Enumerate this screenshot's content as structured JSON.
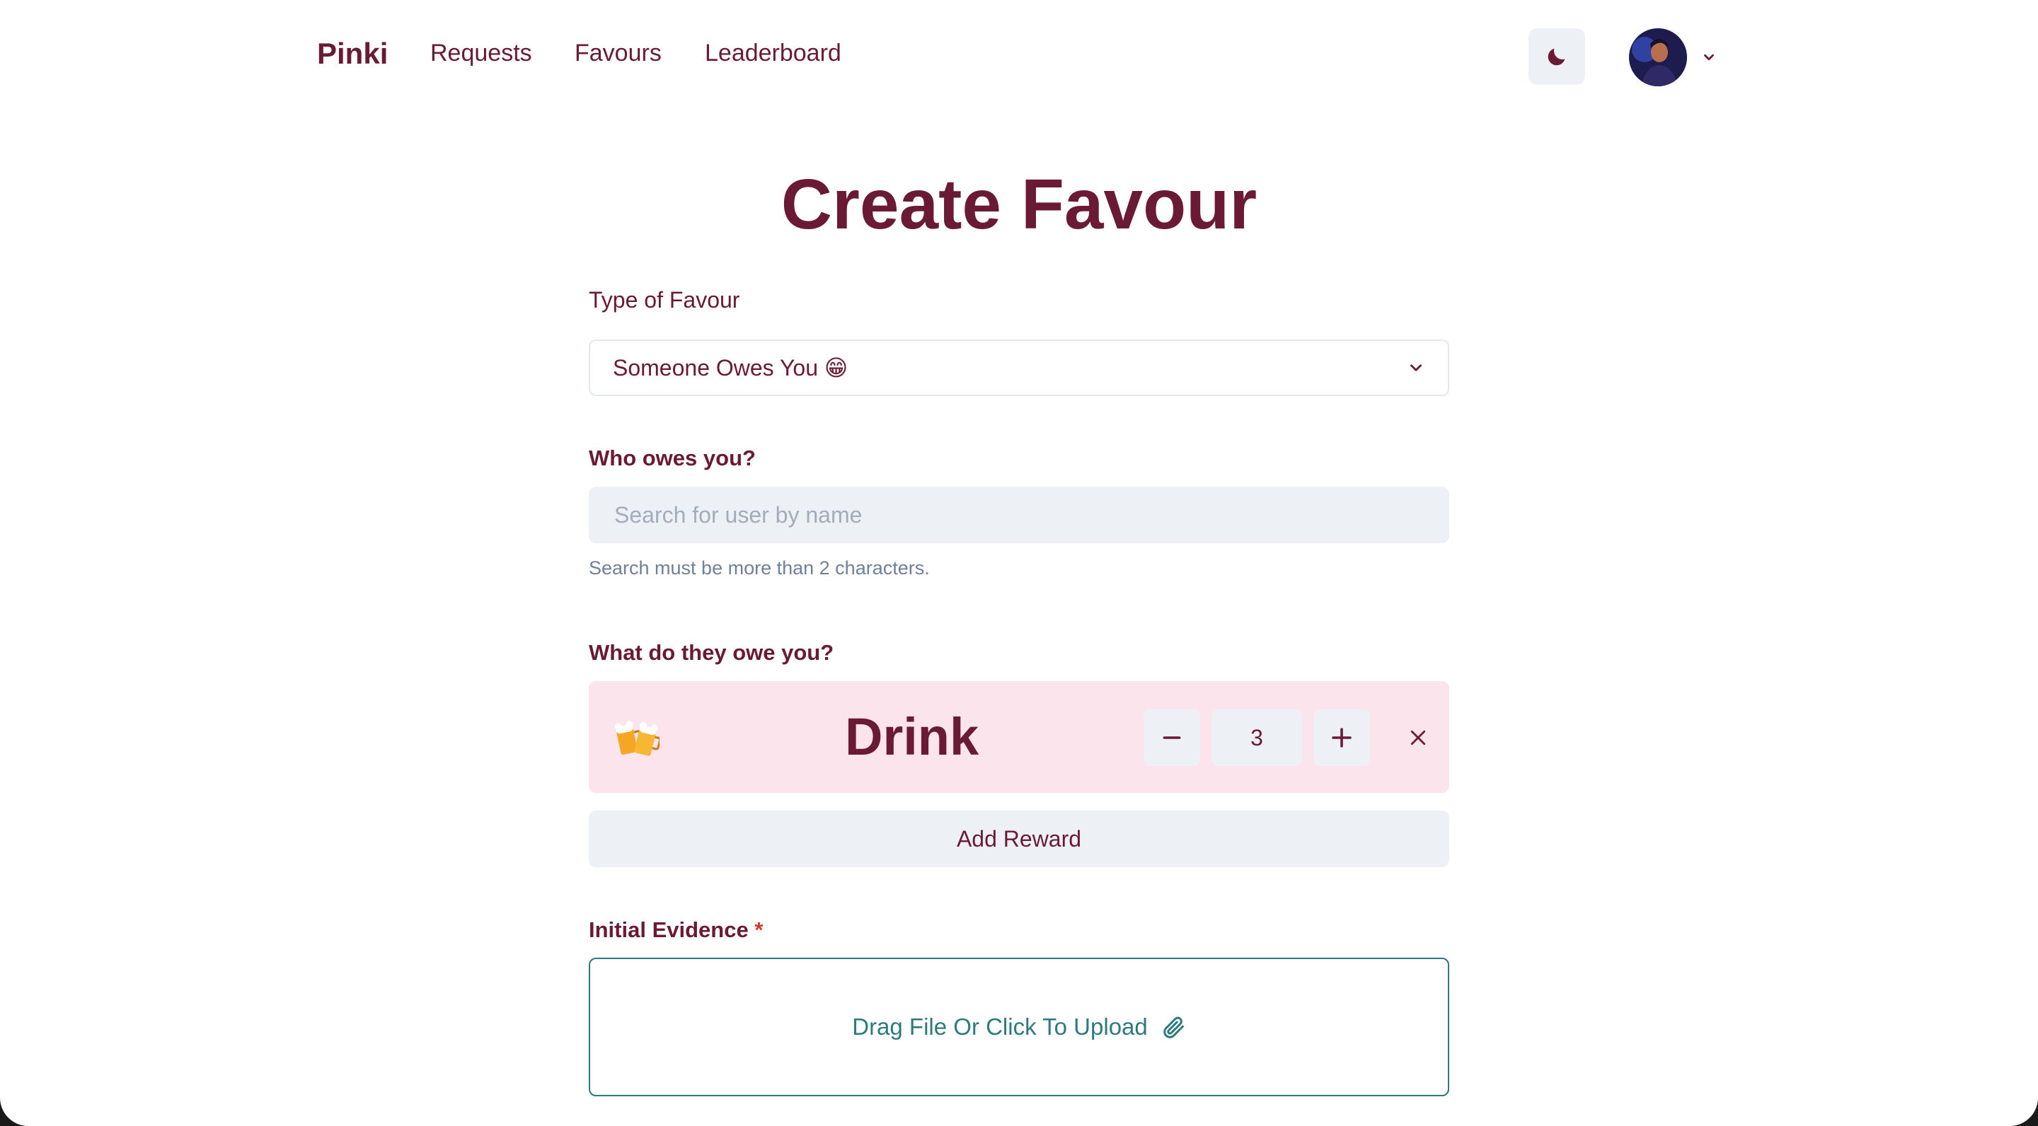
{
  "nav": {
    "brand": "Pinki",
    "links": [
      "Requests",
      "Favours",
      "Leaderboard"
    ],
    "theme_icon": "moon-icon",
    "avatar_icon": "user-avatar",
    "chevron_icon": "chevron-down-icon"
  },
  "page": {
    "title": "Create Favour"
  },
  "form": {
    "type_label": "Type of Favour",
    "type_value": "Someone Owes You 😁",
    "who_label": "Who owes you?",
    "search_placeholder": "Search for user by name",
    "search_helper": "Search must be more than 2 characters.",
    "what_label": "What do they owe you?",
    "reward": {
      "emoji": "🍻",
      "name": "Drink",
      "quantity": "3"
    },
    "add_reward_label": "Add Reward",
    "evidence_label": "Initial Evidence",
    "evidence_required_mark": "*",
    "upload_label": "Drag File Or Click To Upload",
    "upload_icon": "paperclip-icon"
  },
  "colors": {
    "brand": "#6b1a35",
    "reward_bg": "#fbe4ec",
    "input_bg": "#edf1f6",
    "upload_accent": "#2c7a7b",
    "required": "#d0392b"
  }
}
